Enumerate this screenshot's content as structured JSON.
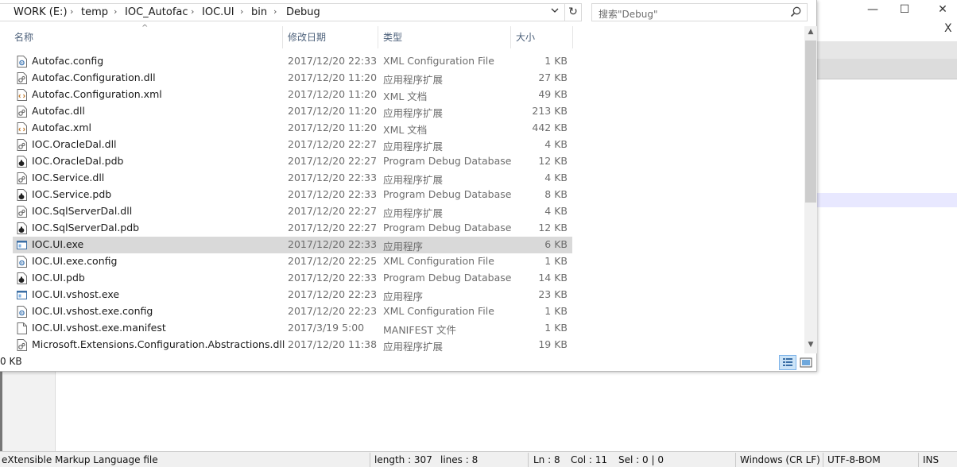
{
  "background_window": {
    "title_controls": [
      "—",
      "☐",
      "✕"
    ],
    "secondary_close": "X"
  },
  "statusbar": {
    "file_type": "eXtensible Markup Language file",
    "length": "length : 307",
    "lines": "lines : 8",
    "ln": "Ln : 8",
    "col": "Col : 11",
    "sel": "Sel : 0 | 0",
    "eol": "Windows (CR LF)",
    "encoding": "UTF-8-BOM",
    "mode": "INS"
  },
  "explorer": {
    "breadcrumb": [
      "WORK (E:)",
      "temp",
      "IOC_Autofac",
      "IOC.UI",
      "bin",
      "Debug"
    ],
    "search_placeholder": "搜索\"Debug\"",
    "columns": {
      "name": "名称",
      "date": "修改日期",
      "type": "类型",
      "size": "大小"
    },
    "files": [
      {
        "name": "Autofac.config",
        "date": "2017/12/20 22:33",
        "type": "XML Configuration File",
        "size": "1 KB",
        "icon": "config-file-icon"
      },
      {
        "name": "Autofac.Configuration.dll",
        "date": "2017/12/20 11:20",
        "type": "应用程序扩展",
        "size": "27 KB",
        "icon": "dll-file-icon"
      },
      {
        "name": "Autofac.Configuration.xml",
        "date": "2017/12/20 11:20",
        "type": "XML 文档",
        "size": "49 KB",
        "icon": "xml-file-icon"
      },
      {
        "name": "Autofac.dll",
        "date": "2017/12/20 11:20",
        "type": "应用程序扩展",
        "size": "213 KB",
        "icon": "dll-file-icon"
      },
      {
        "name": "Autofac.xml",
        "date": "2017/12/20 11:20",
        "type": "XML 文档",
        "size": "442 KB",
        "icon": "xml-file-icon"
      },
      {
        "name": "IOC.OracleDal.dll",
        "date": "2017/12/20 22:27",
        "type": "应用程序扩展",
        "size": "4 KB",
        "icon": "dll-file-icon"
      },
      {
        "name": "IOC.OracleDal.pdb",
        "date": "2017/12/20 22:27",
        "type": "Program Debug Database",
        "size": "12 KB",
        "icon": "pdb-file-icon"
      },
      {
        "name": "IOC.Service.dll",
        "date": "2017/12/20 22:33",
        "type": "应用程序扩展",
        "size": "4 KB",
        "icon": "dll-file-icon"
      },
      {
        "name": "IOC.Service.pdb",
        "date": "2017/12/20 22:33",
        "type": "Program Debug Database",
        "size": "8 KB",
        "icon": "pdb-file-icon"
      },
      {
        "name": "IOC.SqlServerDal.dll",
        "date": "2017/12/20 22:27",
        "type": "应用程序扩展",
        "size": "4 KB",
        "icon": "dll-file-icon"
      },
      {
        "name": "IOC.SqlServerDal.pdb",
        "date": "2017/12/20 22:27",
        "type": "Program Debug Database",
        "size": "12 KB",
        "icon": "pdb-file-icon"
      },
      {
        "name": "IOC.UI.exe",
        "date": "2017/12/20 22:33",
        "type": "应用程序",
        "size": "6 KB",
        "icon": "exe-file-icon",
        "selected": true
      },
      {
        "name": "IOC.UI.exe.config",
        "date": "2017/12/20 22:25",
        "type": "XML Configuration File",
        "size": "1 KB",
        "icon": "config-file-icon"
      },
      {
        "name": "IOC.UI.pdb",
        "date": "2017/12/20 22:33",
        "type": "Program Debug Database",
        "size": "14 KB",
        "icon": "pdb-file-icon"
      },
      {
        "name": "IOC.UI.vshost.exe",
        "date": "2017/12/20 22:23",
        "type": "应用程序",
        "size": "23 KB",
        "icon": "exe-file-icon"
      },
      {
        "name": "IOC.UI.vshost.exe.config",
        "date": "2017/12/20 22:23",
        "type": "XML Configuration File",
        "size": "1 KB",
        "icon": "config-file-icon"
      },
      {
        "name": "IOC.UI.vshost.exe.manifest",
        "date": "2017/3/19 5:00",
        "type": "MANIFEST 文件",
        "size": "1 KB",
        "icon": "blank-file-icon"
      },
      {
        "name": "Microsoft.Extensions.Configuration.Abstractions.dll",
        "date": "2017/12/20 11:38",
        "type": "应用程序扩展",
        "size": "19 KB",
        "icon": "dll-file-icon"
      }
    ],
    "status_text": "0 KB"
  }
}
